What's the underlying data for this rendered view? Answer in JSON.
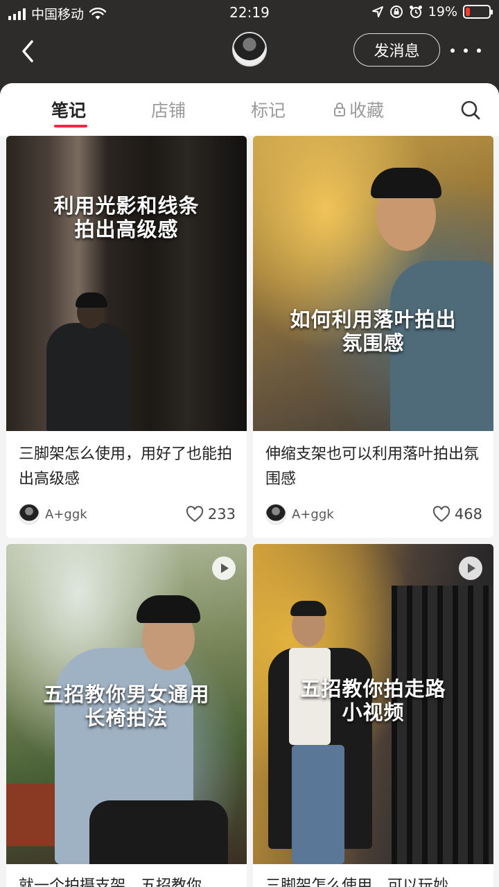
{
  "status_bar": {
    "carrier": "中国移动",
    "time": "22:19",
    "battery_percent": "19%",
    "battery_level": 0.19,
    "icons": [
      "signal-icon",
      "wifi-icon",
      "location-icon",
      "rotation-lock-icon",
      "alarm-icon",
      "battery-icon"
    ]
  },
  "nav": {
    "message_button": "发消息"
  },
  "tabs": [
    {
      "label": "笔记",
      "active": true
    },
    {
      "label": "店铺",
      "active": false
    },
    {
      "label": "标记",
      "active": false
    },
    {
      "label": "收藏",
      "active": false,
      "icon": "lock-icon"
    }
  ],
  "accent_color": "#ff2442",
  "notes": [
    {
      "cover_text": [
        "利用光影和线条",
        "拍出高级感"
      ],
      "title": "三脚架怎么使用，用好了也能拍出高级感",
      "author": "A+ggk",
      "likes": "233"
    },
    {
      "cover_text": [
        "如何利用落叶拍出",
        "氛围感"
      ],
      "title": "伸缩支架也可以利用落叶拍出氛围感",
      "author": "A+ggk",
      "likes": "468"
    },
    {
      "cover_text": [
        "五招教你男女通用",
        "长椅拍法"
      ],
      "title": "就一个拍摄支架，五招教你",
      "is_video": true
    },
    {
      "cover_text": [
        "五招教你拍走路",
        "小视频"
      ],
      "title": "三脚架怎么使用，可以玩妙",
      "is_video": true
    }
  ]
}
